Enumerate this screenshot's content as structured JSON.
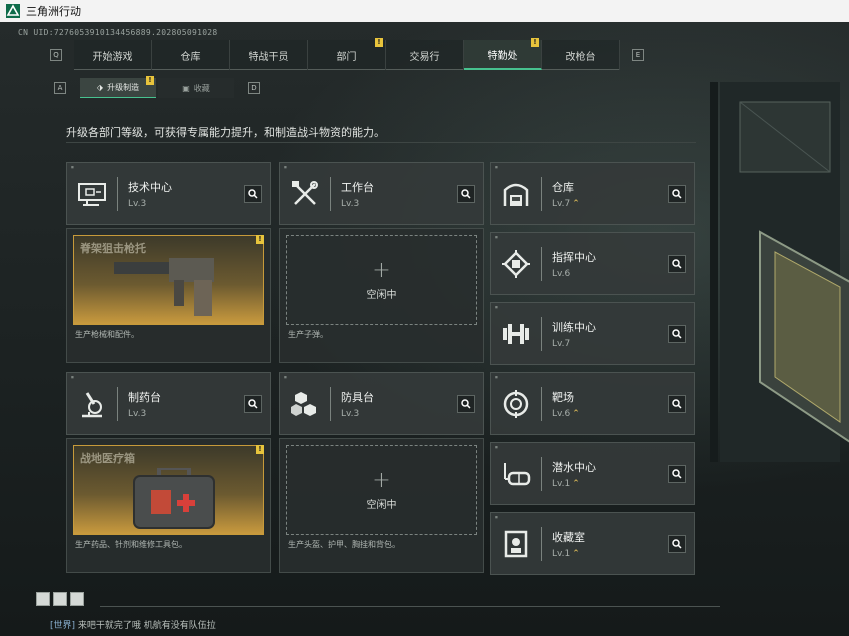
{
  "window": {
    "title": "三角洲行动"
  },
  "header": {
    "uid": "CN UID:7276053910134456889.202805091028"
  },
  "nav": {
    "left_key": "Q",
    "right_key": "E",
    "tabs": [
      {
        "label": "开始游戏",
        "badge": ""
      },
      {
        "label": "仓库",
        "badge": ""
      },
      {
        "label": "特战干员",
        "badge": ""
      },
      {
        "label": "部门",
        "badge": "!"
      },
      {
        "label": "交易行",
        "badge": ""
      },
      {
        "label": "特勤处",
        "badge": "!"
      },
      {
        "label": "改枪台",
        "badge": ""
      }
    ],
    "active_tab": "特勤处"
  },
  "subnav": {
    "left_key": "A",
    "right_key": "D",
    "tabs": [
      {
        "label": "升级制造",
        "badge": "!"
      },
      {
        "label": "收藏",
        "badge": ""
      }
    ]
  },
  "intro": "升级各部门等级，可获得专属能力提升，和制造战斗物资的能力。",
  "stations": {
    "tech": {
      "name": "技术中心",
      "level": "Lv.3",
      "product": "脊架狙击枪托",
      "desc": "生产枪械和配件。",
      "badge": "!"
    },
    "workbench": {
      "name": "工作台",
      "level": "Lv.3",
      "idle": "空闲中",
      "desc": "生产子弹。"
    },
    "pharmacy": {
      "name": "制药台",
      "level": "Lv.3",
      "product": "战地医疗箱",
      "desc": "生产药品、针剂和维修工具包。",
      "badge": "!"
    },
    "armor": {
      "name": "防具台",
      "level": "Lv.3",
      "idle": "空闲中",
      "desc": "生产头盔、护甲、胸挂和背包。"
    }
  },
  "side_facilities": [
    {
      "name": "仓库",
      "level": "Lv.7",
      "upgradable": true
    },
    {
      "name": "指挥中心",
      "level": "Lv.6",
      "upgradable": false
    },
    {
      "name": "训练中心",
      "level": "Lv.7",
      "upgradable": false
    },
    {
      "name": "靶场",
      "level": "Lv.6",
      "upgradable": true
    },
    {
      "name": "潜水中心",
      "level": "Lv.1",
      "upgradable": true
    },
    {
      "name": "收藏室",
      "level": "Lv.1",
      "upgradable": true
    }
  ],
  "upgrade_glyph": "⌃",
  "chat": {
    "channel": "[世界]",
    "message": "来吧干就完了哦 机航有没有队伍拉"
  },
  "colors": {
    "accent": "#47c28f",
    "badge": "#e8c43c",
    "upgrade": "#e6c25a"
  }
}
